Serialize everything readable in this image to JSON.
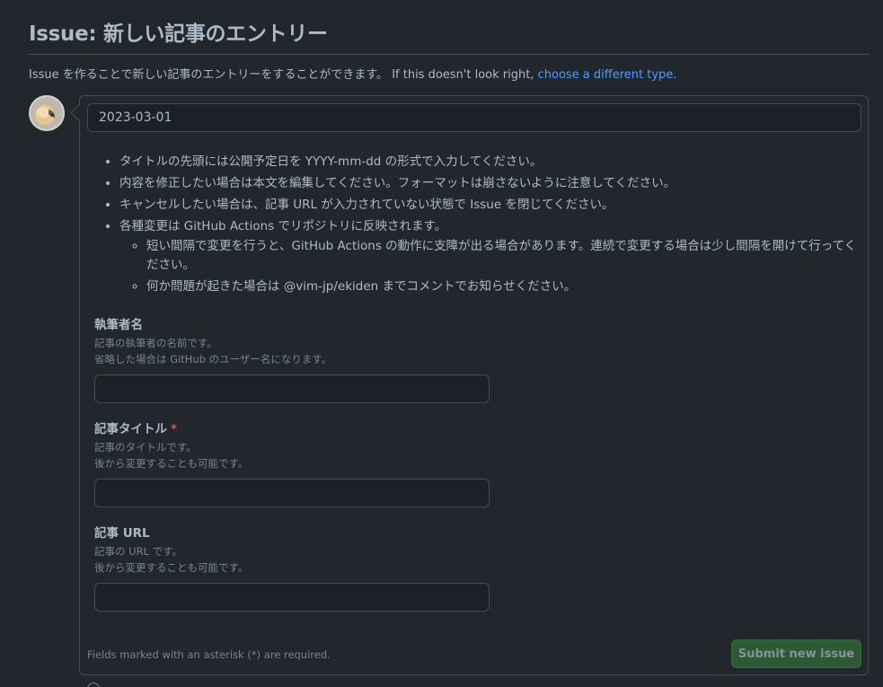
{
  "header": {
    "title": "Issue: 新しい記事のエントリー",
    "description": "Issue を作ることで新しい記事のエントリーをすることができます。 If this doesn't look right, ",
    "change_type_link": "choose a different type."
  },
  "form": {
    "title_value": "2023-03-01",
    "notes": [
      "タイトルの先頭には公開予定日を YYYY-mm-dd の形式で入力してください。",
      "内容を修正したい場合は本文を編集してください。フォーマットは崩さないように注意してください。",
      "キャンセルしたい場合は、記事 URL が入力されていない状態で Issue を閉じてください。",
      "各種変更は GitHub Actions でリポジトリに反映されます。"
    ],
    "sub_notes": [
      "短い間隔で変更を行うと、GitHub Actions の動作に支障が出る場合があります。連続で変更する場合は少し間隔を開けて行ってください。",
      "何か問題が起きた場合は @vim-jp/ekiden までコメントでお知らせください。"
    ],
    "fields": [
      {
        "label": "執筆者名",
        "desc1": "記事の執筆者の名前です。",
        "desc2": "省略した場合は GitHub のユーザー名になります。",
        "value": ""
      },
      {
        "label": "記事タイトル",
        "required_mark": "*",
        "desc1": "記事のタイトルです。",
        "desc2": "後から変更することも可能です。",
        "value": ""
      },
      {
        "label": "記事 URL",
        "desc1": "記事の URL です。",
        "desc2": "後から変更することも可能です。",
        "value": ""
      }
    ],
    "required_note": "Fields marked with an asterisk (*) are required.",
    "submit_label": "Submit new issue"
  },
  "icons": {
    "avatar": "user-avatar",
    "bottom": "circle-icon"
  }
}
